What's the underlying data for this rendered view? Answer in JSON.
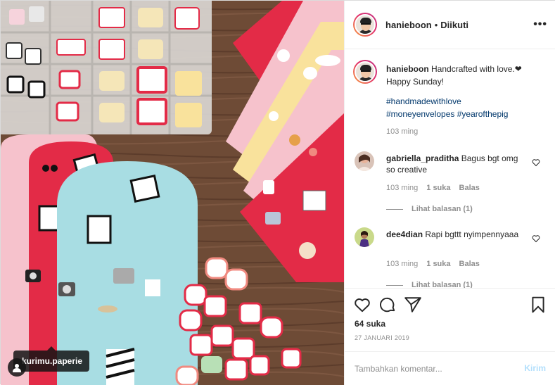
{
  "post": {
    "photo_tag": "kurimu.paperie",
    "photo_alt": "Handcrafted money envelopes with stickers"
  },
  "header": {
    "username": "hanieboon",
    "separator": "•",
    "follow_state": "Diikuti",
    "more_label": "•••"
  },
  "caption": {
    "username": "hanieboon",
    "text": "Handcrafted with love.❤︎ Happy Sunday!",
    "hashtags_line1": "#handmadewithlove",
    "hashtags_line2": "#moneyenvelopes #yearofthepig",
    "time": "103 ming"
  },
  "comments": [
    {
      "username": "gabriella_praditha",
      "text": "Bagus bgt omg so creative",
      "time": "103 ming",
      "likes": "1 suka",
      "reply_label": "Balas",
      "view_replies": "Lihat balasan (1)"
    },
    {
      "username": "dee4dian",
      "text": "Rapi bgttt nyimpennyaaa",
      "time": "103 ming",
      "likes": "1 suka",
      "reply_label": "Balas",
      "view_replies": "Lihat balasan (1)"
    }
  ],
  "actions": {
    "like_icon": "heart-outline",
    "comment_icon": "speech-bubble",
    "share_icon": "paper-plane",
    "save_icon": "bookmark",
    "likes_count": "64 suka",
    "date": "27 JANUARI 2019"
  },
  "add_comment": {
    "placeholder": "Tambahkan komentar...",
    "post_label": "Kirim"
  },
  "colors": {
    "link": "#00376b",
    "muted": "#8e8e8e",
    "post_button_disabled": "#b2dffc",
    "envelope_red": "#e32b47",
    "envelope_blue": "#a8dde3",
    "envelope_pink": "#f6c2cc",
    "envelope_yellow": "#f9e29c",
    "table_wood": "#6b4a35"
  }
}
